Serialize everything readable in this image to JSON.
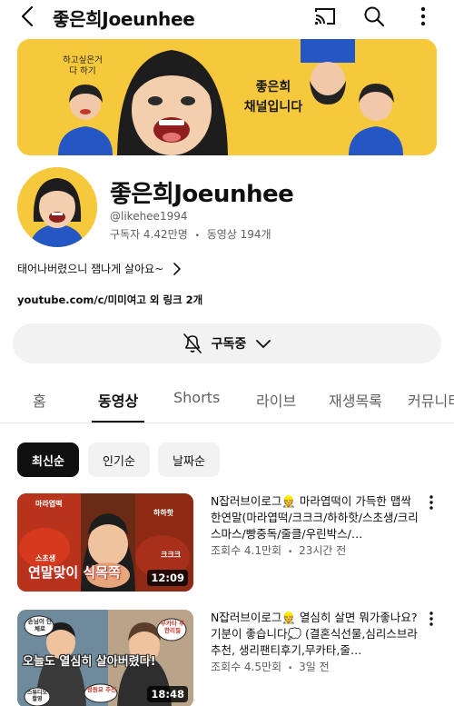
{
  "header": {
    "title": "좋은희Joeunhee"
  },
  "banner": {
    "caption_left": "하고싶은거 다 하기",
    "caption_main_line1": "좋은희",
    "caption_main_line2": "채널입니다"
  },
  "channel": {
    "name": "좋은희Joeunhee",
    "handle": "@likehee1994",
    "subscribers": "구독자 4.42만명",
    "videos": "동영상 194개",
    "separator": "•",
    "description": "태어나버렸으니 잼나게 살아요~",
    "links": "youtube.com/c/미미여고 외 링크 2개"
  },
  "subscribe": {
    "label": "구독중"
  },
  "tabs": [
    {
      "label": "홈"
    },
    {
      "label": "동영상"
    },
    {
      "label": "Shorts"
    },
    {
      "label": "라이브"
    },
    {
      "label": "재생목록"
    },
    {
      "label": "커뮤니티"
    }
  ],
  "filters": [
    {
      "label": "최신순"
    },
    {
      "label": "인기순"
    },
    {
      "label": "날짜순"
    }
  ],
  "videos": [
    {
      "title": "N잡러브이로그👷 마라엽떡이 가득한 맵싹한연말(마라엽떡/크크크/하하핫/스초생/크리스마스/빵중독/줄클/우린박스/…",
      "views": "조회수 4.1만회",
      "age": "23시간 전",
      "duration": "12:09",
      "thumb_text": "연말맞이 식목쪽",
      "thumb_tags": [
        "마라엽떡",
        "하하핫",
        "스초생",
        "크크크"
      ]
    },
    {
      "title": "N잡러브이로그👷 열심히 살면 뭐가좋나요? 기분이 좋습니다💭 (결혼식선물,심리스브라추천, 생리팬티후기,무카타,줄…",
      "views": "조회수 4.5만회",
      "age": "3일 전",
      "duration": "18:48",
      "thumb_text": "오늘도 열심히 살아버렸다!",
      "thumb_tags": [
        "손님이 단체로",
        "무카타 무한리필",
        "정원요 추천",
        "스튜디오 촬영"
      ]
    }
  ],
  "colors": {
    "banner_yellow": "#f6c83c",
    "chip_selected": "#0f0f0f",
    "chip_bg": "#f2f2f2",
    "secondary_text": "#606060"
  }
}
